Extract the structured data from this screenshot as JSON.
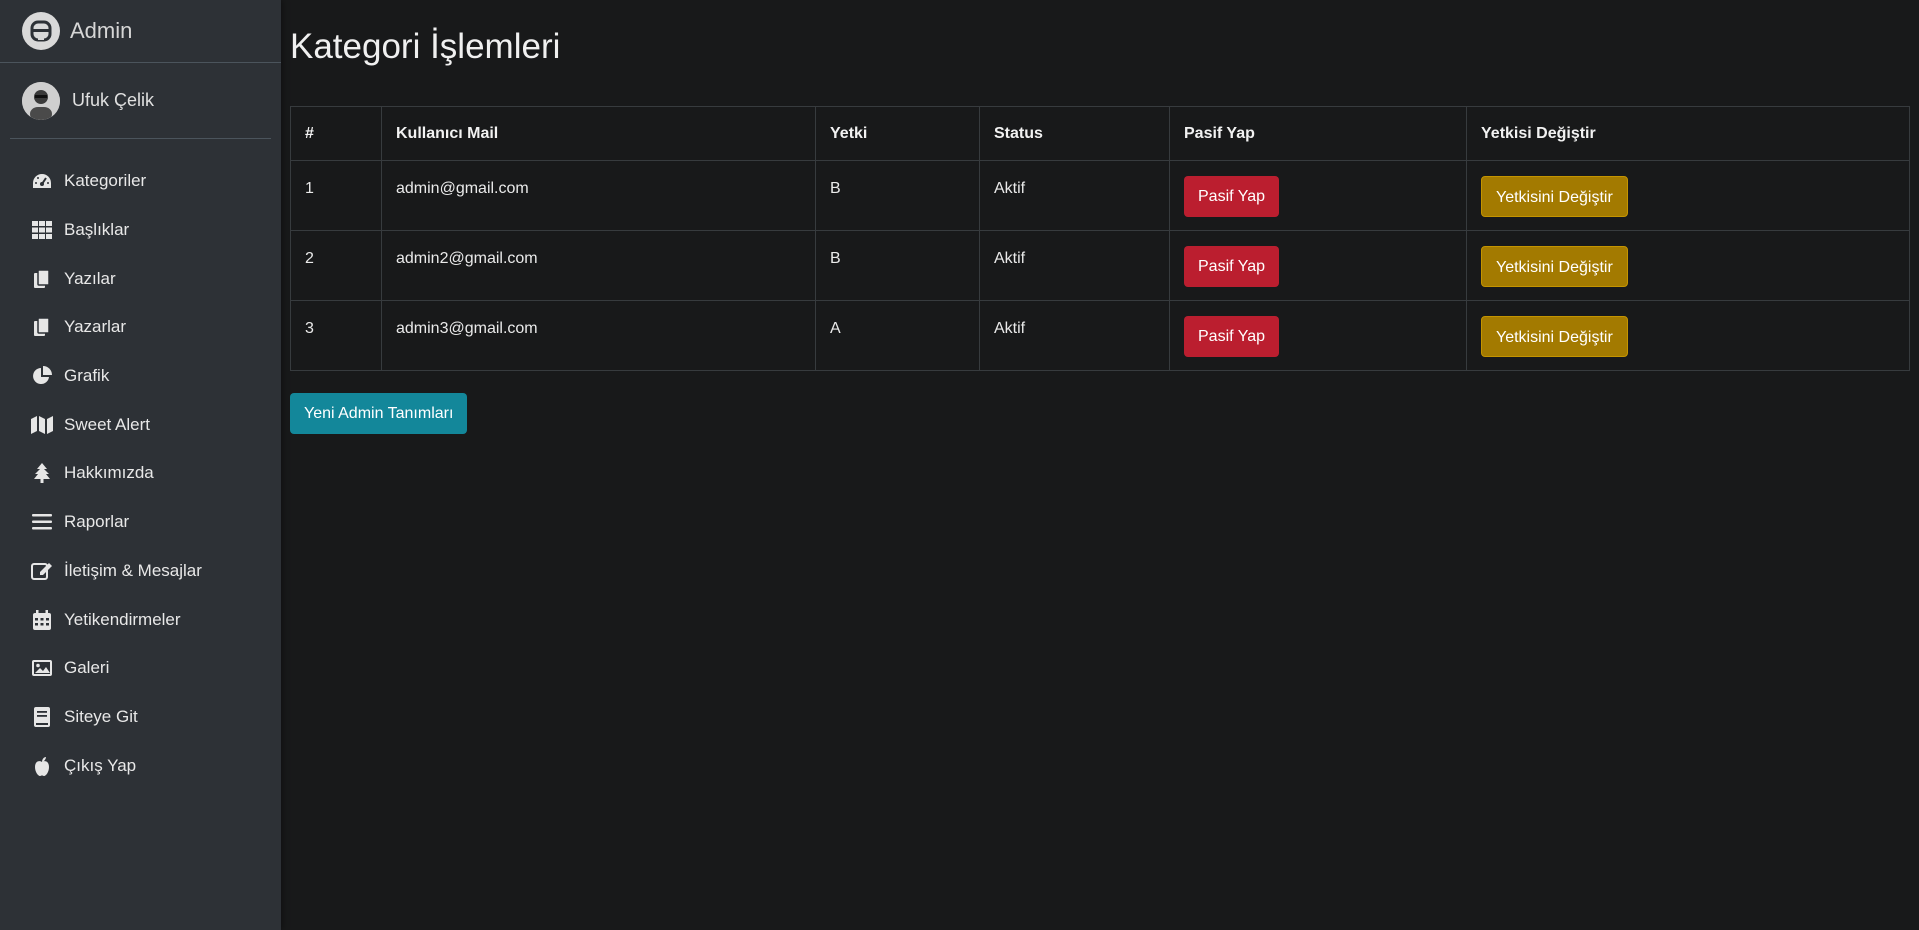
{
  "brand": {
    "title": "Admin"
  },
  "user": {
    "name": "Ufuk Çelik"
  },
  "sidebar": {
    "items": [
      {
        "label": "Kategoriler",
        "icon": "tachometer-icon"
      },
      {
        "label": "Başlıklar",
        "icon": "grid-icon"
      },
      {
        "label": "Yazılar",
        "icon": "copy-icon"
      },
      {
        "label": "Yazarlar",
        "icon": "copy-icon"
      },
      {
        "label": "Grafik",
        "icon": "pie-chart-icon"
      },
      {
        "label": "Sweet Alert",
        "icon": "map-icon"
      },
      {
        "label": "Hakkımızda",
        "icon": "tree-icon"
      },
      {
        "label": "Raporlar",
        "icon": "bars-icon"
      },
      {
        "label": "İletişim & Mesajlar",
        "icon": "edit-icon"
      },
      {
        "label": "Yetikendirmeler",
        "icon": "calendar-icon"
      },
      {
        "label": "Galeri",
        "icon": "image-icon"
      },
      {
        "label": "Siteye Git",
        "icon": "book-icon"
      },
      {
        "label": "Çıkış Yap",
        "icon": "apple-icon"
      }
    ]
  },
  "main": {
    "title": "Kategori İşlemleri",
    "table": {
      "headers": [
        "#",
        "Kullanıcı Mail",
        "Yetki",
        "Status",
        "Pasif Yap",
        "Yetkisi Değiştir"
      ],
      "rows": [
        {
          "id": "1",
          "mail": "admin@gmail.com",
          "role": "B",
          "status": "Aktif",
          "deactivate": "Pasif Yap",
          "change_role": "Yetkisini Değiştir"
        },
        {
          "id": "2",
          "mail": "admin2@gmail.com",
          "role": "B",
          "status": "Aktif",
          "deactivate": "Pasif Yap",
          "change_role": "Yetkisini Değiştir"
        },
        {
          "id": "3",
          "mail": "admin3@gmail.com",
          "role": "A",
          "status": "Aktif",
          "deactivate": "Pasif Yap",
          "change_role": "Yetkisini Değiştir"
        }
      ]
    },
    "new_admin_button": "Yeni Admin Tanımları"
  },
  "colors": {
    "danger": "#bb1e2f",
    "warning": "#a37a00",
    "info": "#13879a",
    "sidebar_bg": "#2d3136",
    "page_bg": "#18191a"
  }
}
